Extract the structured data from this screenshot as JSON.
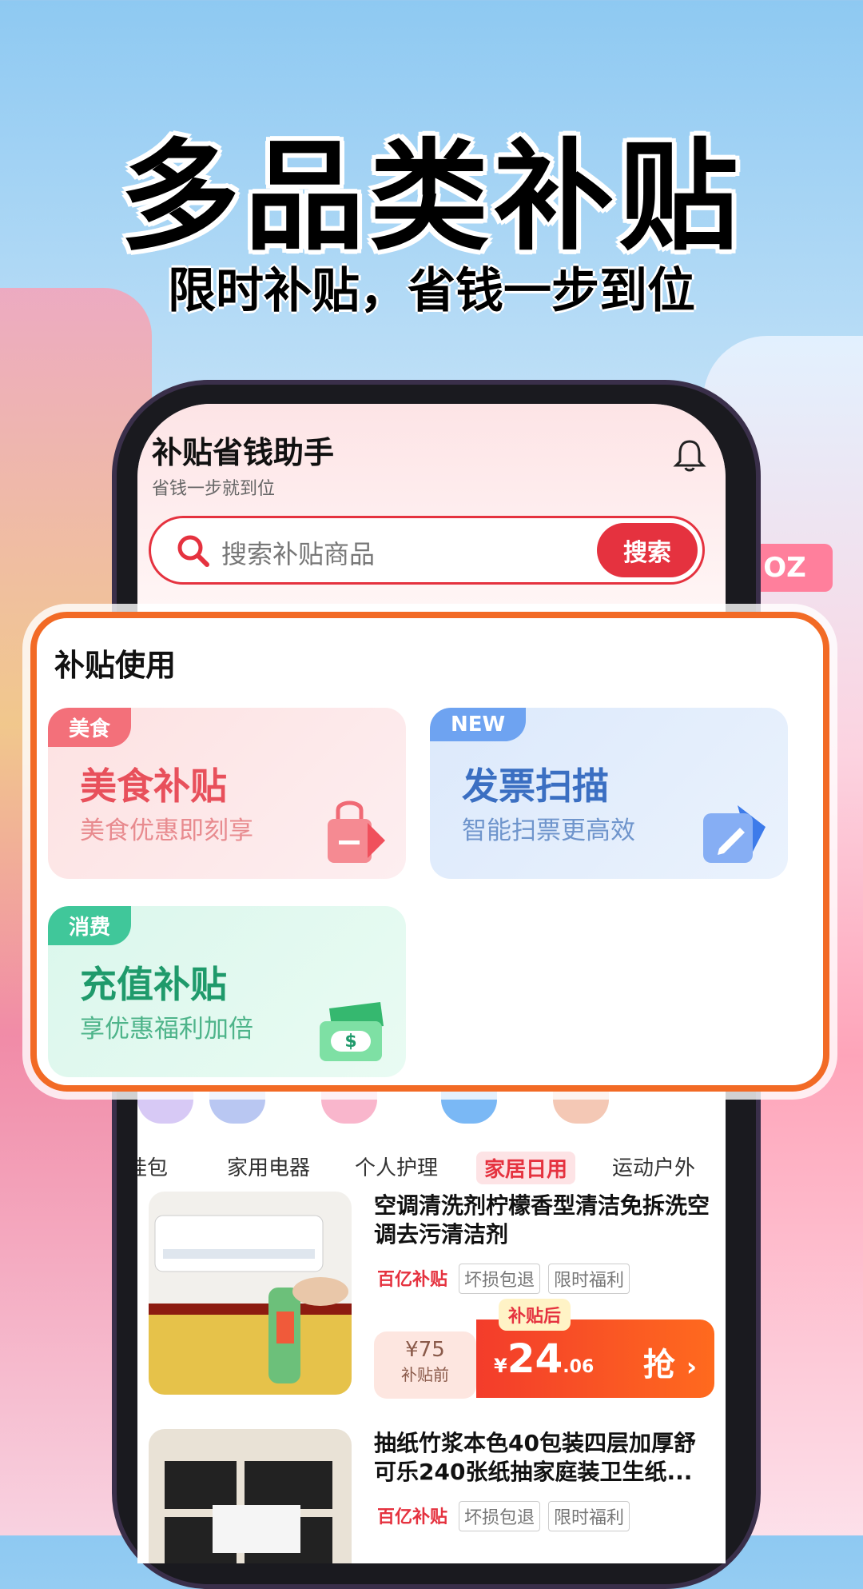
{
  "headline": "多品类补贴",
  "subline": "限时补贴，省钱一步到位",
  "bg_sign": "OZ",
  "app": {
    "title": "补贴省钱助手",
    "subtitle": "省钱一步就到位",
    "search": {
      "placeholder": "搜索补贴商品",
      "button": "搜索"
    }
  },
  "panel": {
    "title": "补贴使用",
    "cards": [
      {
        "badge": "美食",
        "title": "美食补贴",
        "subtitle": "美食优惠即刻享",
        "icon": "shopping-bag-icon"
      },
      {
        "badge": "NEW",
        "title": "发票扫描",
        "subtitle": "智能扫票更高效",
        "icon": "edit-pen-icon"
      },
      {
        "badge": "消费",
        "title": "充值补贴",
        "subtitle": "享优惠福利加倍",
        "icon": "money-icon"
      }
    ]
  },
  "categories": [
    {
      "label": "挂包"
    },
    {
      "label": "家用电器"
    },
    {
      "label": "个人护理"
    },
    {
      "label": "家居日用",
      "active": true
    },
    {
      "label": "运动户外"
    }
  ],
  "products": [
    {
      "title": "空调清洗剂柠檬香型清洁免拆洗空调去污清洁剂",
      "tags": [
        "百亿补贴",
        "坏损包退",
        "限时福利"
      ],
      "price_before_value": "¥75",
      "price_before_label": "补贴前",
      "price_after_label": "补贴后",
      "price_after_currency": "¥",
      "price_after_int": "24",
      "price_after_dec": ".06",
      "grab": "抢"
    },
    {
      "title": "抽纸竹浆本色40包装四层加厚舒可乐240张纸抽家庭装卫生纸...",
      "tags": [
        "百亿补贴",
        "坏损包退",
        "限时福利"
      ]
    }
  ],
  "colors": {
    "accent": "#e5323f",
    "panel_border": "#f26a25"
  }
}
